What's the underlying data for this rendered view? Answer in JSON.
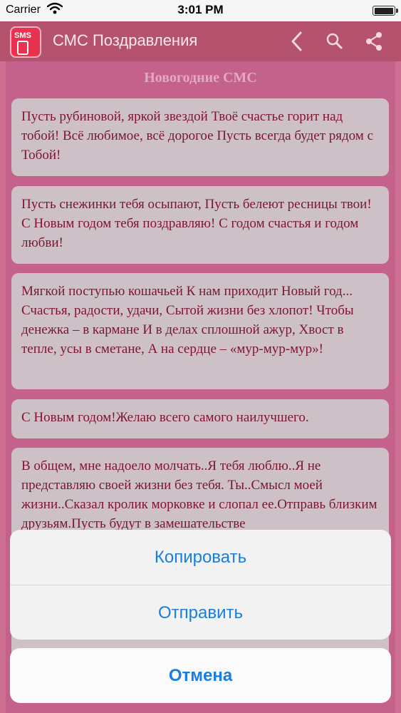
{
  "status_bar": {
    "carrier": "Carrier",
    "time": "3:01 PM"
  },
  "header": {
    "logo_text": "SMS",
    "title": "СМС Поздравления"
  },
  "section": {
    "title": "Новогодние СМС"
  },
  "messages": [
    "Пусть рубиновой, яркой звездой Твоё счастье горит над тобой! Всё любимое, всё дорогое Пусть всегда будет рядом с Тобой!",
    "Пусть снежинки тебя осыпают, Пусть белеют ресницы твои! С Новым годом тебя поздравляю! С годом счастья и годом любви!",
    "Мягкой поступью кошачьей К нам приходит Новый год... Счастья, радости, удачи, Сытой жизни без хлопот! Чтобы денежка – в кармане И в делах сплошной ажур, Хвост в тепле, усы в сметане, А на сердце – «мур-мур-мур»!",
    "С Новым годом!Желаю всего самого наилучшего.",
    "В общем, мне надоело молчать..Я тебя люблю..Я не представляю своей жизни без тебя. Ты..Смысл моей жизни..Сказал кролик морковке и слопал ее.Отправь близким друзьям.Пусть будут в замешательстве"
  ],
  "action_sheet": {
    "copy": "Копировать",
    "send": "Отправить",
    "cancel": "Отмена"
  },
  "colors": {
    "header": "#b5536f",
    "content_bg": "#c5628c",
    "card_bg": "#cdc0c6",
    "card_text": "#7d1530",
    "sheet_text": "#1a7ee0"
  },
  "icons": [
    "wifi-icon",
    "battery-icon",
    "sms-phone-icon",
    "back-icon",
    "search-icon",
    "share-icon"
  ]
}
